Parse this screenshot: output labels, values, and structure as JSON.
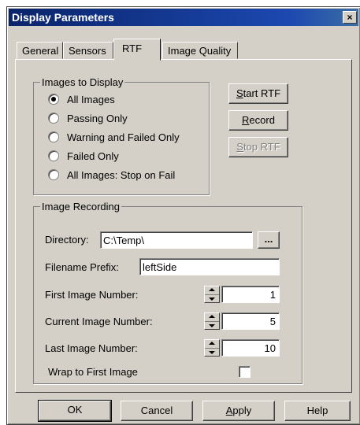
{
  "window": {
    "title": "Display Parameters",
    "close_glyph": "×"
  },
  "tabs": [
    {
      "label": "General"
    },
    {
      "label": "Sensors"
    },
    {
      "label": "RTF"
    },
    {
      "label": "Image Quality"
    }
  ],
  "images_group": {
    "title": "Images to Display",
    "options": [
      {
        "label": "All Images",
        "checked": true
      },
      {
        "label": "Passing Only",
        "checked": false
      },
      {
        "label": "Warning and Failed Only",
        "checked": false
      },
      {
        "label": "Failed Only",
        "checked": false
      },
      {
        "label": "All Images: Stop on Fail",
        "checked": false
      }
    ]
  },
  "rtf_buttons": {
    "start": {
      "mnemonic": "S",
      "rest": "tart RTF"
    },
    "record": {
      "mnemonic": "R",
      "rest": "ecord"
    },
    "stop": {
      "mnemonic": "S",
      "rest": "top RTF",
      "disabled": true
    }
  },
  "recording_group": {
    "title": "Image Recording",
    "directory_label": "Directory:",
    "directory_value": "C:\\Temp\\",
    "browse_label": "...",
    "prefix_label": "Filename Prefix:",
    "prefix_value": "leftSide",
    "first_label": "First Image Number:",
    "first_value": "1",
    "current_label": "Current Image Number:",
    "current_value": "5",
    "last_label": "Last Image Number:",
    "last_value": "10",
    "wrap_label": "Wrap to First Image",
    "wrap_checked": false
  },
  "footer": {
    "ok": "OK",
    "cancel": "Cancel",
    "apply": {
      "mnemonic": "A",
      "rest": "pply"
    },
    "help": "Help"
  }
}
